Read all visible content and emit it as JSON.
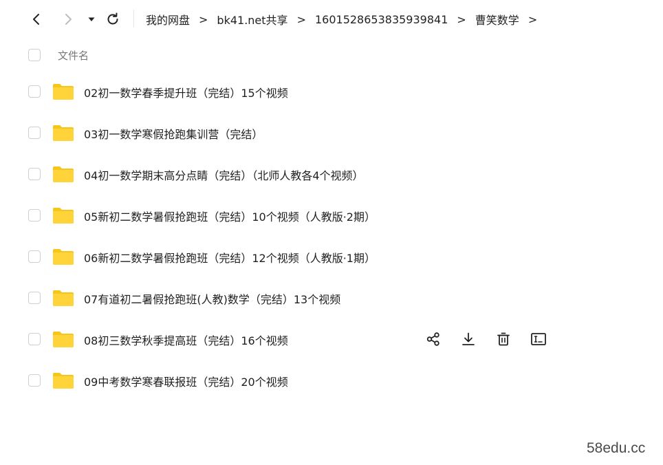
{
  "breadcrumb": {
    "items": [
      "我的网盘",
      "bk41.net共享",
      "1601528653835939841",
      "曹笑数学"
    ],
    "separator": ">"
  },
  "list_header": {
    "name_label": "文件名"
  },
  "files": [
    {
      "name": "02初一数学春季提升班（完结）15个视频"
    },
    {
      "name": "03初一数学寒假抢跑集训营（完结）"
    },
    {
      "name": "04初一数学期末高分点睛（完结）（北师人教各4个视频）"
    },
    {
      "name": "05新初二数学暑假抢跑班（完结）10个视频（人教版·2期）"
    },
    {
      "name": "06新初二数学暑假抢跑班（完结）12个视频（人教版·1期）"
    },
    {
      "name": "07有道初二暑假抢跑班(人教)数学（完结）13个视频"
    },
    {
      "name": "08初三数学秋季提高班（完结）16个视频"
    },
    {
      "name": "09中考数学寒春联报班（完结）20个视频"
    }
  ],
  "hover_row_actions": [
    "share-icon",
    "download-icon",
    "delete-icon",
    "rename-icon"
  ],
  "colors": {
    "folder": "#FFD43B",
    "folder_tab": "#F5C518",
    "text": "#1f1f1f",
    "checkbox_border": "#cfcfcf"
  },
  "watermark": "58edu.cc"
}
